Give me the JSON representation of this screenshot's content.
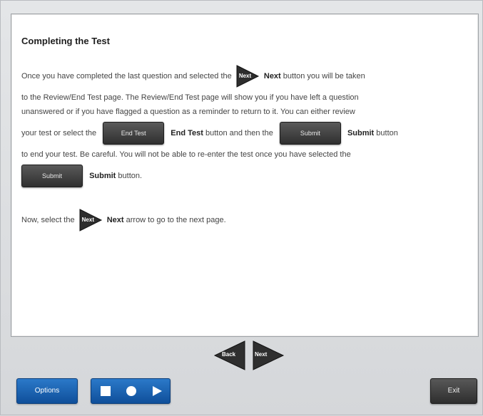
{
  "content": {
    "title": "Completing the Test",
    "para1": {
      "l1_pre": "Once you have completed the last question and selected the",
      "l1_next_icon_label": "Next",
      "l1_bold": "Next",
      "l1_post": "button you will be taken",
      "l2": "to the Review/End Test page. The Review/End Test page will show you if you have left a question",
      "l3": "unanswered or if you have flagged a question as a reminder to return to it. You can either review",
      "l4_pre": "your test or select the",
      "end_test_btn_label": "End Test",
      "l4_bold1": "End Test",
      "l4_mid": "button and then the",
      "submit_btn_label": "Submit",
      "l4_bold2": "Submit",
      "l4_post": "button",
      "l5": "to end your test. Be careful. You will not be able to re-enter the test once you have selected the",
      "submit_btn2_label": "Submit",
      "l6_bold": "Submit",
      "l6_post": "button."
    },
    "para2": {
      "pre": "Now, select the",
      "next_icon_label": "Next",
      "bold": "Next",
      "post": "arrow to go to the next page."
    }
  },
  "nav": {
    "back_label": "Back",
    "next_label": "Next"
  },
  "bottom": {
    "options_label": "Options",
    "exit_label": "Exit",
    "media_icons": [
      "stop-icon",
      "record-icon",
      "play-icon"
    ]
  },
  "colors": {
    "accent_blue": "#1f65b3",
    "dark_button": "#3a3a3a",
    "background": "#d9dbdd"
  }
}
